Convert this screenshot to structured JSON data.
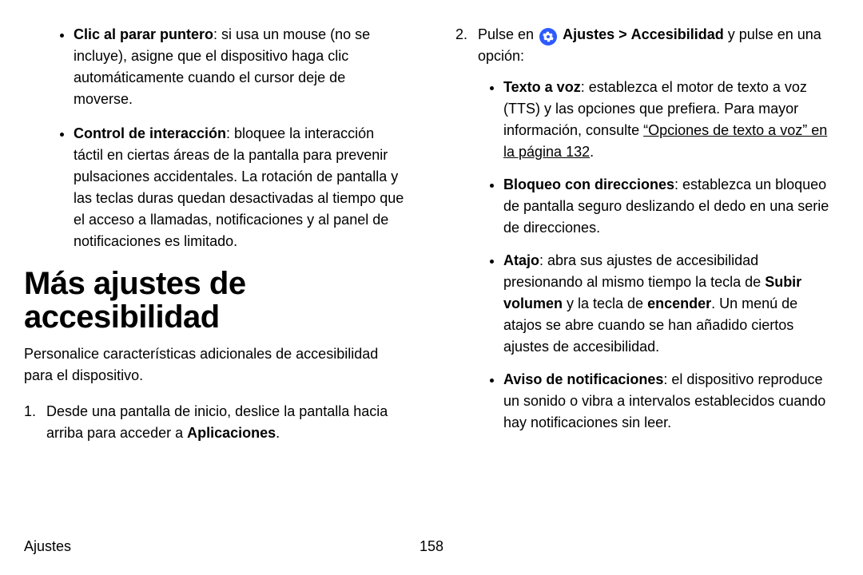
{
  "left": {
    "bullets": [
      {
        "term": "Clic al parar puntero",
        "text": ": si usa un mouse (no se incluye), asigne que el dispositivo haga clic automáticamente cuando el cursor deje de moverse."
      },
      {
        "term": "Control de interacción",
        "text": ": bloquee la interacción táctil en ciertas áreas de la pantalla para prevenir pulsaciones accidentales. La rotación de pantalla y las teclas duras quedan desactivadas al tiempo que el acceso a llamadas, notificaciones y al panel de notificaciones es limitado."
      }
    ],
    "heading": "Más ajustes de accesibilidad",
    "intro": "Personalice características adicionales de accesibilidad para el dispositivo.",
    "step1_num": "1.",
    "step1_pre": "Desde una pantalla de inicio, deslice la pantalla hacia arriba para acceder a ",
    "step1_bold": "Aplicaciones",
    "step1_post": "."
  },
  "right": {
    "step2_num": "2.",
    "step2_pre": "Pulse en ",
    "step2_settings": "Ajustes",
    "step2_gt": ">",
    "step2_path": "Accesibilidad",
    "step2_post": " y pulse en una opción:",
    "bullets": [
      {
        "term": "Texto a voz",
        "text_pre": ": establezca el motor de texto a voz (TTS) y las opciones que prefiera. Para mayor información, consulte ",
        "link": "“Opciones de texto a voz” en la página 132",
        "text_post": "."
      },
      {
        "term": "Bloqueo con direcciones",
        "text": ": establezca un bloqueo de pantalla seguro deslizando el dedo en una serie de direcciones."
      },
      {
        "term": "Atajo",
        "text_pre": ": abra sus ajustes de accesibilidad presionando al mismo tiempo la tecla de ",
        "bold1": "Subir volumen",
        "mid": " y la tecla de ",
        "bold2": "encender",
        "text_post": ". Un menú de atajos se abre cuando se han añadido ciertos ajustes de accesibilidad."
      },
      {
        "term": "Aviso de notificaciones",
        "text": ": el dispositivo reproduce un sonido o vibra a intervalos establecidos cuando hay notificaciones sin leer."
      }
    ]
  },
  "footer": {
    "section": "Ajustes",
    "page": "158"
  }
}
